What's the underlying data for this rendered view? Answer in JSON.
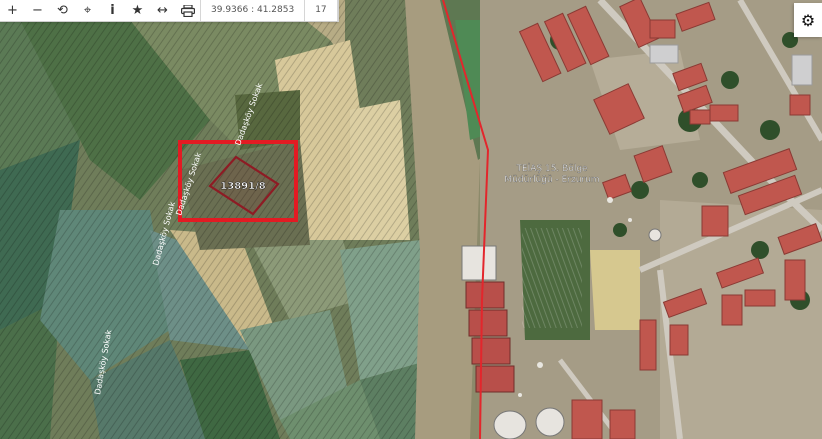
{
  "toolbar": {
    "coordinates": "39.9366 : 41.2853",
    "zoom_level": "17",
    "icons": [
      "plus-icon",
      "minus-icon",
      "refresh-icon",
      "crosshair-icon",
      "info-icon",
      "star-icon",
      "measure-icon",
      "print-icon"
    ]
  },
  "map": {
    "parcel_label": "13891/8",
    "street_labels": [
      "Dadaşköy Sokak",
      "Dadaşköy Sokak",
      "Dadaşköy Sokak",
      "Dadaşköy Sokak"
    ],
    "poi_label_line1": "TEİAŞ 15. Bölge",
    "poi_label_line2": "Müdürlüğü - Erzurum",
    "highlight_color": "#e21b23",
    "parcel_color": "#8e1b24",
    "line_color": "#e3262c"
  },
  "settings": {
    "icon": "gear-icon"
  }
}
